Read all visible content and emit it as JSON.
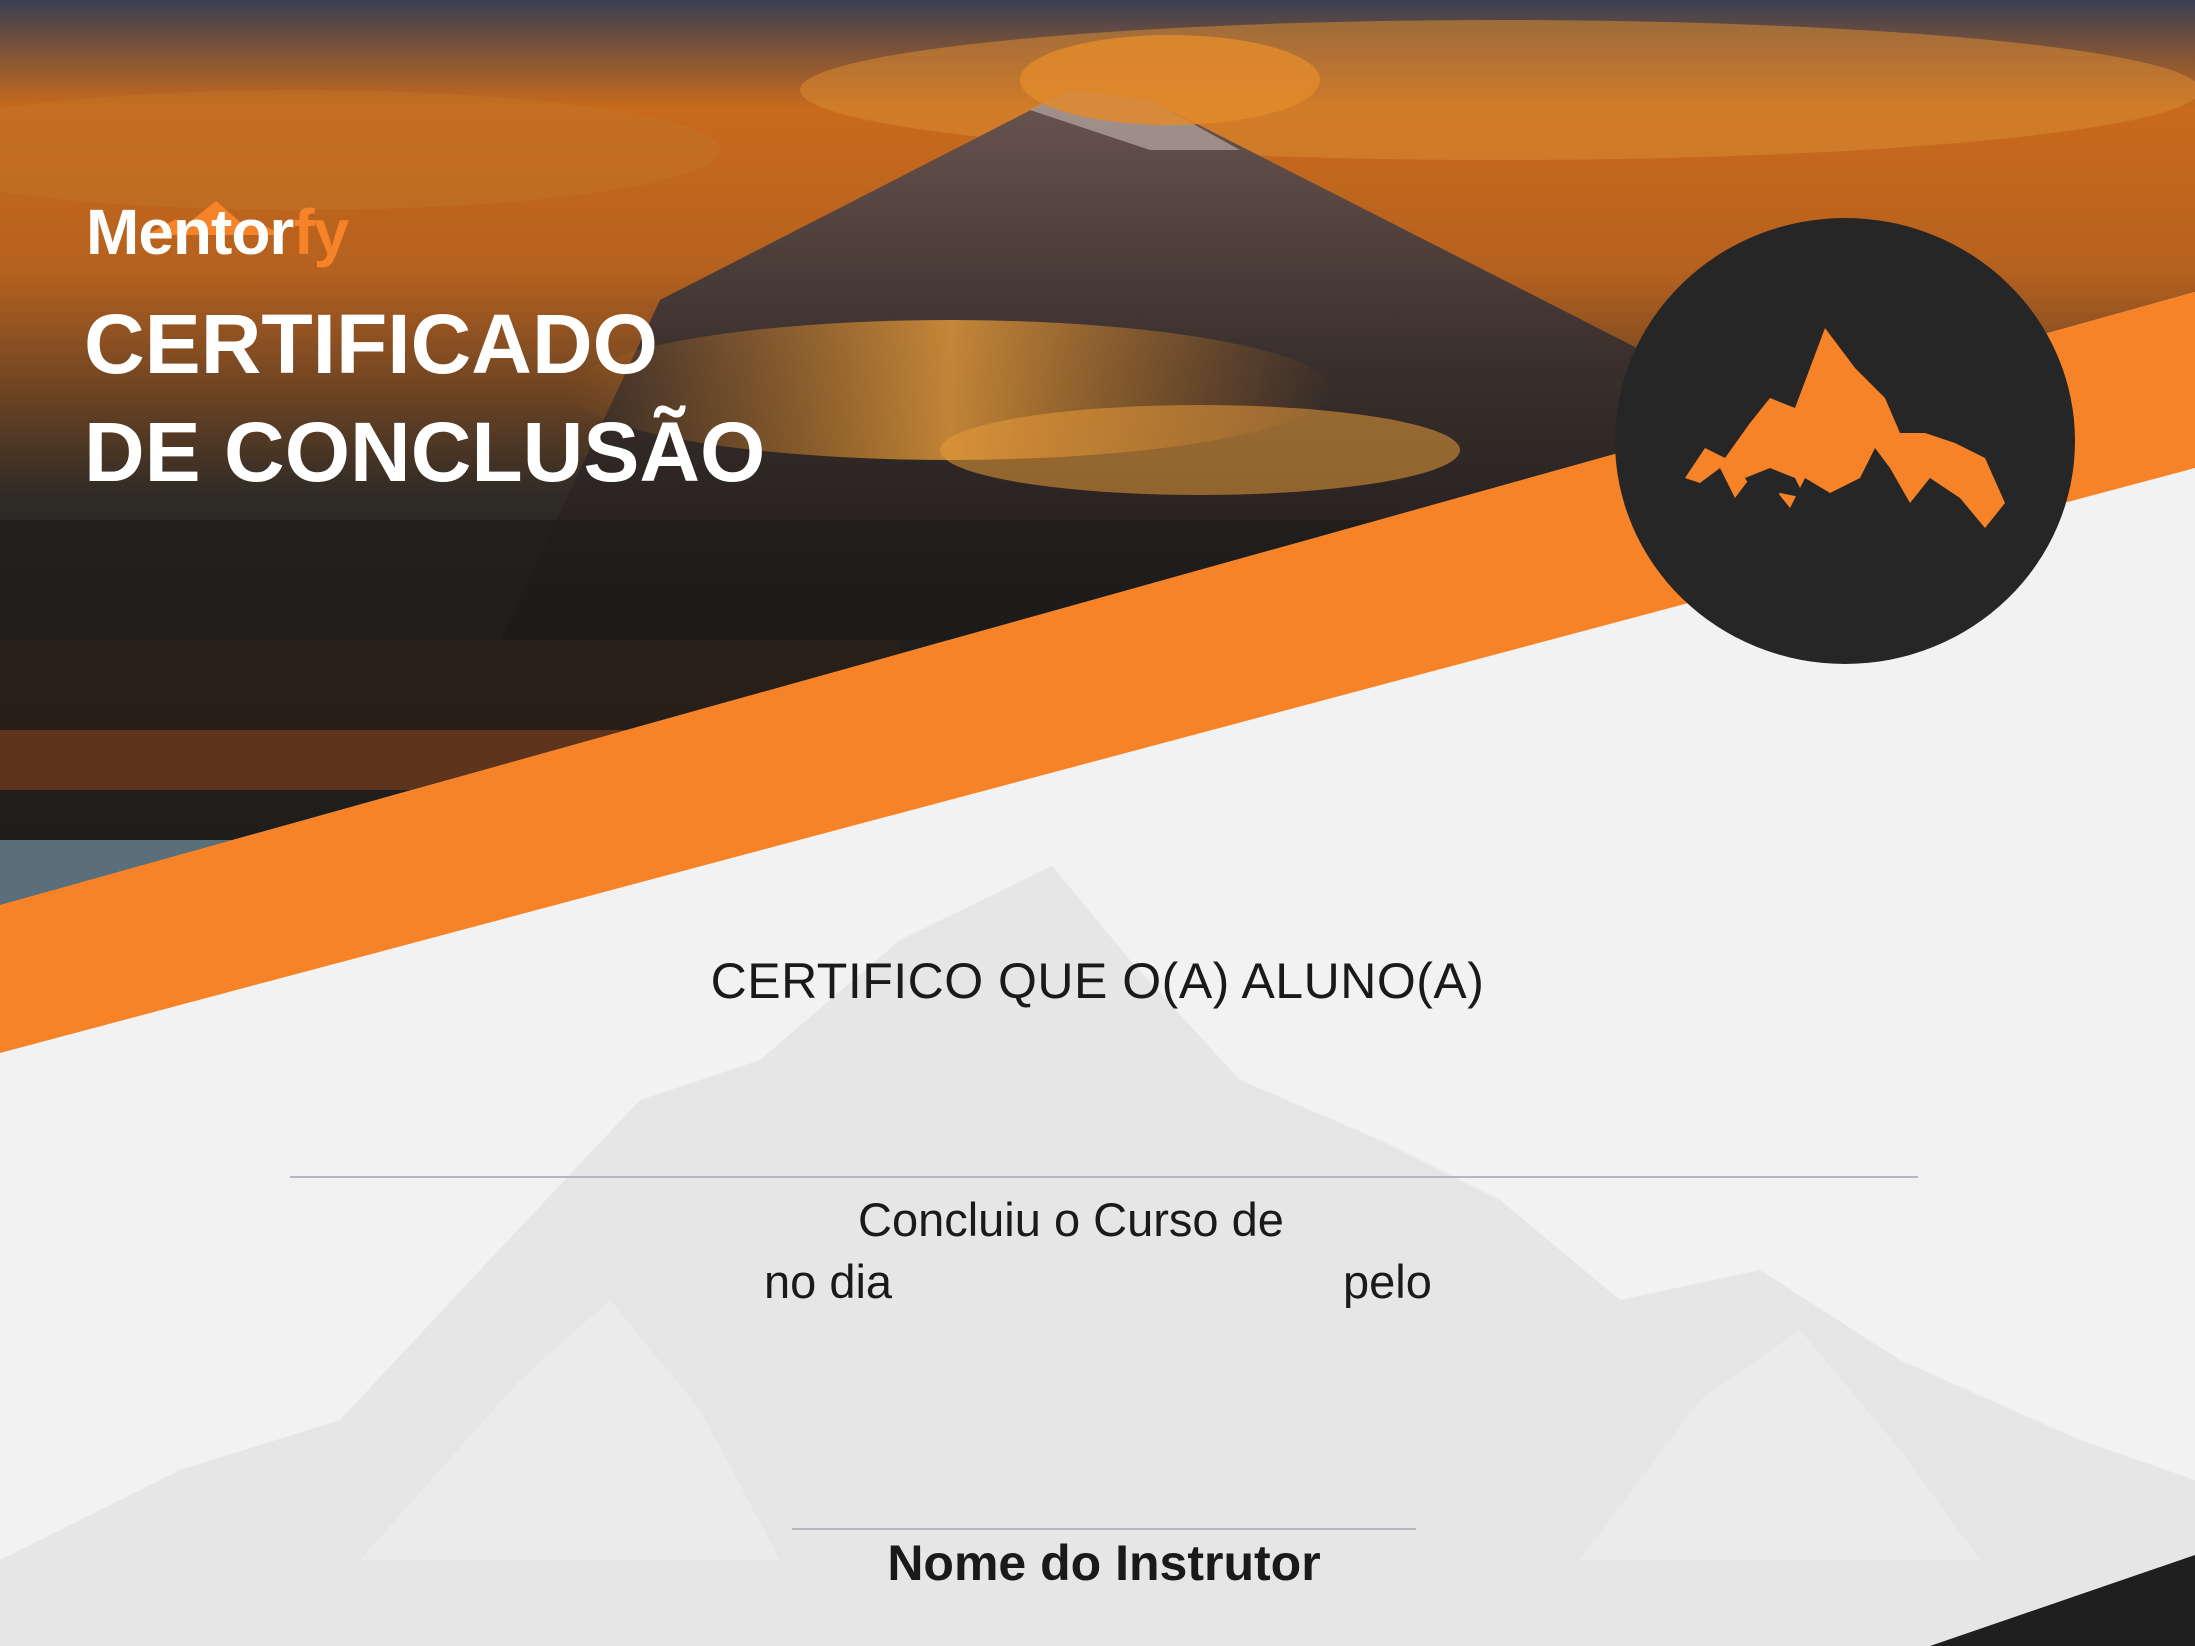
{
  "brand": {
    "name_main": "Mentor",
    "name_accent": "fy",
    "logo_icon": "mountain-logo-icon"
  },
  "title": {
    "line1": "CERTIFICADO",
    "line2": "DE CONCLUSÃO"
  },
  "badge": {
    "icon": "mountain-icon"
  },
  "body": {
    "statement": "CERTIFICO QUE O(A) ALUNO(A)",
    "course_text": "Concluiu o Curso de",
    "date_text": "no dia",
    "by_text": "pelo"
  },
  "signature": {
    "instructor_label": "Nome do Instrutor"
  },
  "colors": {
    "accent": "#f68327",
    "dark": "#262626",
    "background": "#f2f2f2",
    "text": "#1a1a1a",
    "line": "#b5b8c3"
  }
}
